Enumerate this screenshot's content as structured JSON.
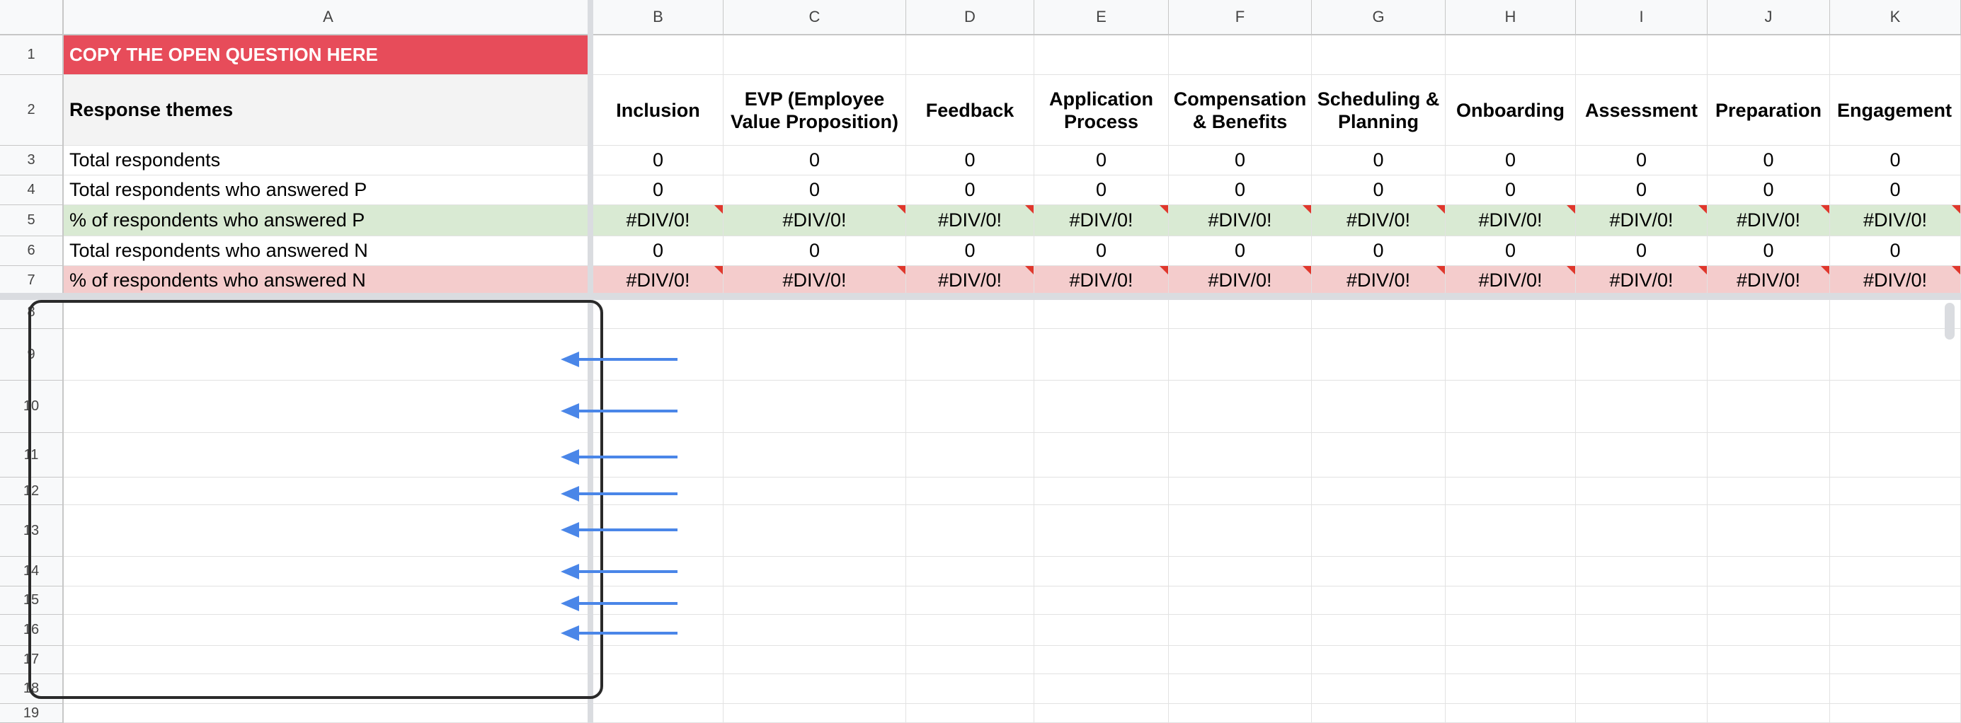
{
  "columns": [
    "A",
    "B",
    "C",
    "D",
    "E",
    "F",
    "G",
    "H",
    "I",
    "J",
    "K"
  ],
  "rows": [
    "1",
    "2",
    "3",
    "4",
    "5",
    "6",
    "7",
    "8",
    "9",
    "10",
    "11",
    "12",
    "13",
    "14",
    "15",
    "16",
    "17",
    "18",
    "19"
  ],
  "a1": "COPY THE OPEN QUESTION HERE",
  "a2": "Response themes",
  "themes": [
    "Inclusion",
    "EVP (Employee Value Proposition)",
    "Feedback",
    "Application Process",
    "Compensation & Benefits",
    "Scheduling & Planning",
    "Onboarding",
    "Assessment",
    "Preparation",
    "Engagement"
  ],
  "metric_labels": [
    "Total respondents",
    "Total respondents who answered P",
    "% of respondents who answered P",
    "Total respondents who answered N",
    "% of respondents who answered N"
  ],
  "metric_values": [
    "0",
    "0",
    "#DIV/0!",
    "0",
    "#DIV/0!"
  ],
  "colors": {
    "title_bg": "#e74c5a",
    "p_row_bg": "#d9ead3",
    "n_row_bg": "#f4cccc",
    "arrow": "#4a86e8",
    "note": "#e0372c"
  }
}
